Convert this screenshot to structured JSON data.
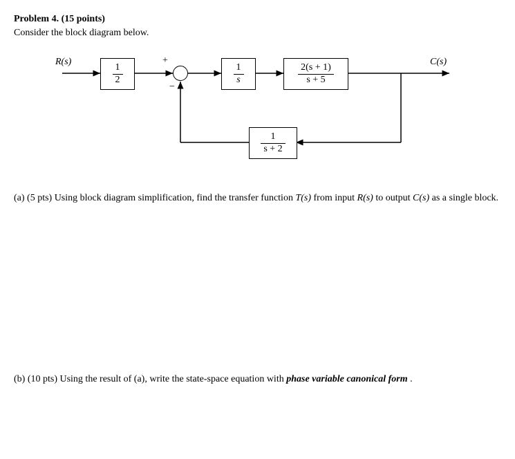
{
  "problem": {
    "title": "Problem 4. (15 points)",
    "subtitle": "Consider the block diagram below."
  },
  "diagram": {
    "input_label": "R(s)",
    "output_label": "C(s)",
    "block1": {
      "num": "1",
      "den": "2"
    },
    "block2": {
      "num": "1",
      "den": "s"
    },
    "block3": {
      "num": "2(s + 1)",
      "den": "s + 5"
    },
    "block_fb": {
      "num": "1",
      "den": "s + 2"
    },
    "sign_plus": "+",
    "sign_minus": "−"
  },
  "parts": {
    "a": {
      "label": "(a) (5 pts) Using block diagram simplification, find the transfer function ",
      "tf": "T(s)",
      "mid": " from input ",
      "rs": "R(s)",
      "mid2": " to output ",
      "cs": "C(s)",
      "end": " as a single block."
    },
    "b": {
      "label": "(b) (10 pts) Using the result of (a), write the state-space equation with ",
      "emph": "phase variable canonical form",
      "end": "."
    }
  }
}
